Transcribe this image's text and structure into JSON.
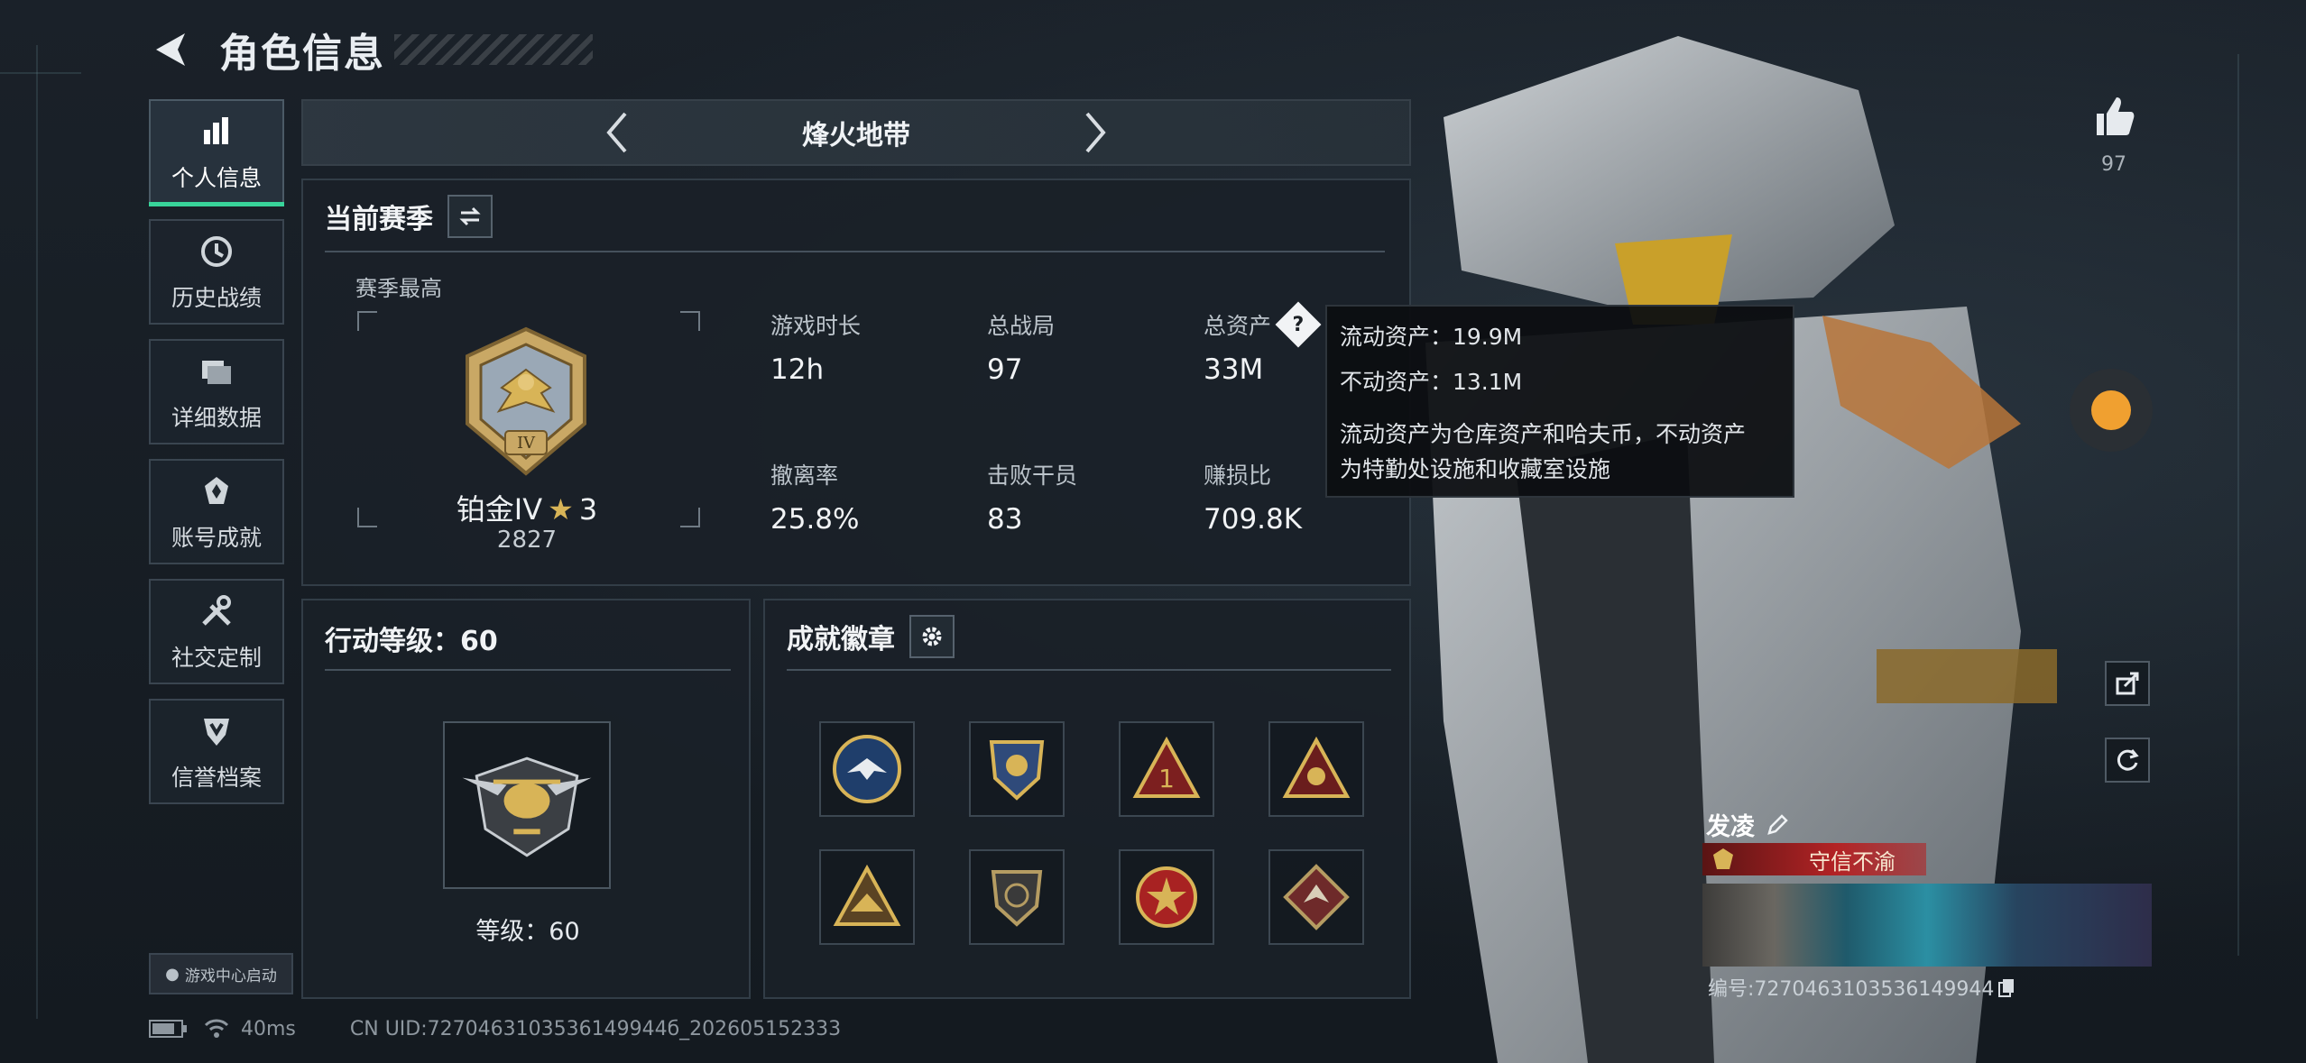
{
  "header": {
    "title": "角色信息"
  },
  "nav": {
    "items": [
      {
        "label": "个人信息",
        "icon": "bar-chart-icon"
      },
      {
        "label": "历史战绩",
        "icon": "history-clock-icon"
      },
      {
        "label": "详细数据",
        "icon": "folder-icon"
      },
      {
        "label": "账号成就",
        "icon": "achievement-icon"
      },
      {
        "label": "社交定制",
        "icon": "tools-icon"
      },
      {
        "label": "信誉档案",
        "icon": "shield-icon"
      }
    ],
    "game_center_label": "游戏中心启动"
  },
  "mode": {
    "title": "烽火地带"
  },
  "season": {
    "title": "当前赛季",
    "subtitle": "赛季最高",
    "rank_name": "铂金IV",
    "rank_stars": "3",
    "rank_badge_roman": "IV",
    "rank_score": "2827",
    "stats": [
      {
        "label": "游戏时长",
        "value": "12h"
      },
      {
        "label": "总战局",
        "value": "97"
      },
      {
        "label": "总资产",
        "value": "33M"
      },
      {
        "label": "撤离率",
        "value": "25.8%"
      },
      {
        "label": "击败干员",
        "value": "83"
      },
      {
        "label": "赚损比",
        "value": "709.8K"
      }
    ]
  },
  "tooltip": {
    "liquid": "流动资产：19.9M",
    "fixed": "不动资产：13.1M",
    "desc_line1": "流动资产为仓库资产和哈夫币，不动资产",
    "desc_line2": "为特勤处设施和收藏室设施"
  },
  "level": {
    "title": "行动等级：60",
    "text": "等级：60"
  },
  "achievements": {
    "title": "成就徽章"
  },
  "likes": {
    "count": "97"
  },
  "player": {
    "name": "发凌",
    "title": "守信不渝",
    "uid": "编号:7270463103536149944"
  },
  "status": {
    "ping": "40ms",
    "uid": "CN UID:7270463103536149944б_202605152333"
  },
  "colors": {
    "accent": "#38d49a",
    "gold": "#d8b457",
    "title_red": "#b32325"
  }
}
